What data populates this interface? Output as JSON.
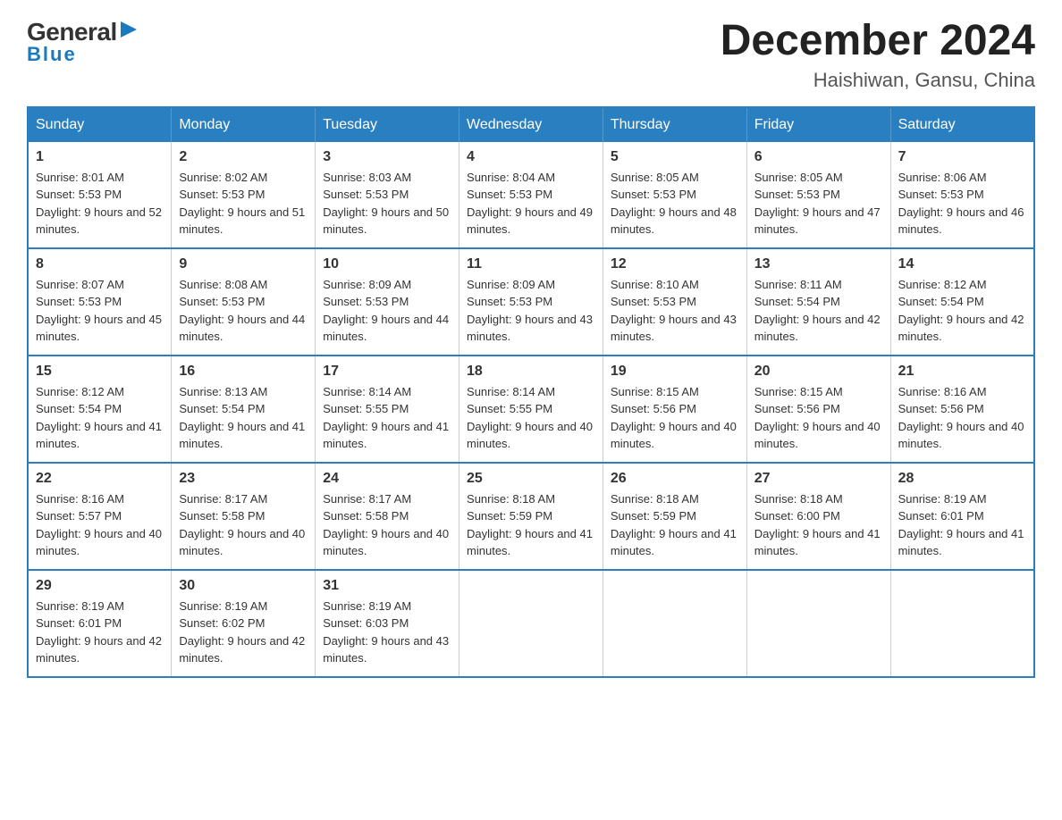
{
  "logo": {
    "general": "General",
    "arrow": "▶",
    "blue": "Blue"
  },
  "header": {
    "month_year": "December 2024",
    "location": "Haishiwan, Gansu, China"
  },
  "weekdays": [
    "Sunday",
    "Monday",
    "Tuesday",
    "Wednesday",
    "Thursday",
    "Friday",
    "Saturday"
  ],
  "weeks": [
    [
      {
        "day": "1",
        "sunrise": "8:01 AM",
        "sunset": "5:53 PM",
        "daylight": "9 hours and 52 minutes."
      },
      {
        "day": "2",
        "sunrise": "8:02 AM",
        "sunset": "5:53 PM",
        "daylight": "9 hours and 51 minutes."
      },
      {
        "day": "3",
        "sunrise": "8:03 AM",
        "sunset": "5:53 PM",
        "daylight": "9 hours and 50 minutes."
      },
      {
        "day": "4",
        "sunrise": "8:04 AM",
        "sunset": "5:53 PM",
        "daylight": "9 hours and 49 minutes."
      },
      {
        "day": "5",
        "sunrise": "8:05 AM",
        "sunset": "5:53 PM",
        "daylight": "9 hours and 48 minutes."
      },
      {
        "day": "6",
        "sunrise": "8:05 AM",
        "sunset": "5:53 PM",
        "daylight": "9 hours and 47 minutes."
      },
      {
        "day": "7",
        "sunrise": "8:06 AM",
        "sunset": "5:53 PM",
        "daylight": "9 hours and 46 minutes."
      }
    ],
    [
      {
        "day": "8",
        "sunrise": "8:07 AM",
        "sunset": "5:53 PM",
        "daylight": "9 hours and 45 minutes."
      },
      {
        "day": "9",
        "sunrise": "8:08 AM",
        "sunset": "5:53 PM",
        "daylight": "9 hours and 44 minutes."
      },
      {
        "day": "10",
        "sunrise": "8:09 AM",
        "sunset": "5:53 PM",
        "daylight": "9 hours and 44 minutes."
      },
      {
        "day": "11",
        "sunrise": "8:09 AM",
        "sunset": "5:53 PM",
        "daylight": "9 hours and 43 minutes."
      },
      {
        "day": "12",
        "sunrise": "8:10 AM",
        "sunset": "5:53 PM",
        "daylight": "9 hours and 43 minutes."
      },
      {
        "day": "13",
        "sunrise": "8:11 AM",
        "sunset": "5:54 PM",
        "daylight": "9 hours and 42 minutes."
      },
      {
        "day": "14",
        "sunrise": "8:12 AM",
        "sunset": "5:54 PM",
        "daylight": "9 hours and 42 minutes."
      }
    ],
    [
      {
        "day": "15",
        "sunrise": "8:12 AM",
        "sunset": "5:54 PM",
        "daylight": "9 hours and 41 minutes."
      },
      {
        "day": "16",
        "sunrise": "8:13 AM",
        "sunset": "5:54 PM",
        "daylight": "9 hours and 41 minutes."
      },
      {
        "day": "17",
        "sunrise": "8:14 AM",
        "sunset": "5:55 PM",
        "daylight": "9 hours and 41 minutes."
      },
      {
        "day": "18",
        "sunrise": "8:14 AM",
        "sunset": "5:55 PM",
        "daylight": "9 hours and 40 minutes."
      },
      {
        "day": "19",
        "sunrise": "8:15 AM",
        "sunset": "5:56 PM",
        "daylight": "9 hours and 40 minutes."
      },
      {
        "day": "20",
        "sunrise": "8:15 AM",
        "sunset": "5:56 PM",
        "daylight": "9 hours and 40 minutes."
      },
      {
        "day": "21",
        "sunrise": "8:16 AM",
        "sunset": "5:56 PM",
        "daylight": "9 hours and 40 minutes."
      }
    ],
    [
      {
        "day": "22",
        "sunrise": "8:16 AM",
        "sunset": "5:57 PM",
        "daylight": "9 hours and 40 minutes."
      },
      {
        "day": "23",
        "sunrise": "8:17 AM",
        "sunset": "5:58 PM",
        "daylight": "9 hours and 40 minutes."
      },
      {
        "day": "24",
        "sunrise": "8:17 AM",
        "sunset": "5:58 PM",
        "daylight": "9 hours and 40 minutes."
      },
      {
        "day": "25",
        "sunrise": "8:18 AM",
        "sunset": "5:59 PM",
        "daylight": "9 hours and 41 minutes."
      },
      {
        "day": "26",
        "sunrise": "8:18 AM",
        "sunset": "5:59 PM",
        "daylight": "9 hours and 41 minutes."
      },
      {
        "day": "27",
        "sunrise": "8:18 AM",
        "sunset": "6:00 PM",
        "daylight": "9 hours and 41 minutes."
      },
      {
        "day": "28",
        "sunrise": "8:19 AM",
        "sunset": "6:01 PM",
        "daylight": "9 hours and 41 minutes."
      }
    ],
    [
      {
        "day": "29",
        "sunrise": "8:19 AM",
        "sunset": "6:01 PM",
        "daylight": "9 hours and 42 minutes."
      },
      {
        "day": "30",
        "sunrise": "8:19 AM",
        "sunset": "6:02 PM",
        "daylight": "9 hours and 42 minutes."
      },
      {
        "day": "31",
        "sunrise": "8:19 AM",
        "sunset": "6:03 PM",
        "daylight": "9 hours and 43 minutes."
      },
      null,
      null,
      null,
      null
    ]
  ]
}
